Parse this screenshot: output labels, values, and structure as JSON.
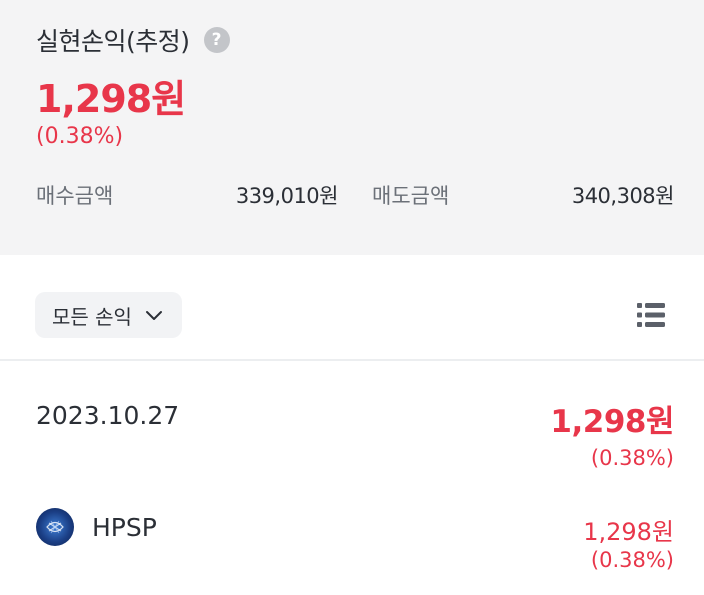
{
  "summary": {
    "title": "실현손익(추정)",
    "help_icon": "question-circle-icon",
    "profit": "1,298원",
    "profit_rate": "(0.38%)",
    "buy_label": "매수금액",
    "buy_amount": "339,010원",
    "sell_label": "매도금액",
    "sell_amount": "340,308원"
  },
  "filter": {
    "label": "모든 손익",
    "chevron_icon": "chevron-down-icon",
    "view_icon": "list-view-icon"
  },
  "records": [
    {
      "date": "2023.10.27",
      "profit": "1,298원",
      "profit_rate": "(0.38%)",
      "stocks": [
        {
          "name": "HPSP",
          "profit": "1,298원",
          "profit_rate": "(0.38%)"
        }
      ]
    }
  ],
  "colors": {
    "positive": "#e8364a",
    "summary_background": "#f4f4f5",
    "text_primary": "#2b2f36",
    "text_secondary": "#6b7078"
  }
}
